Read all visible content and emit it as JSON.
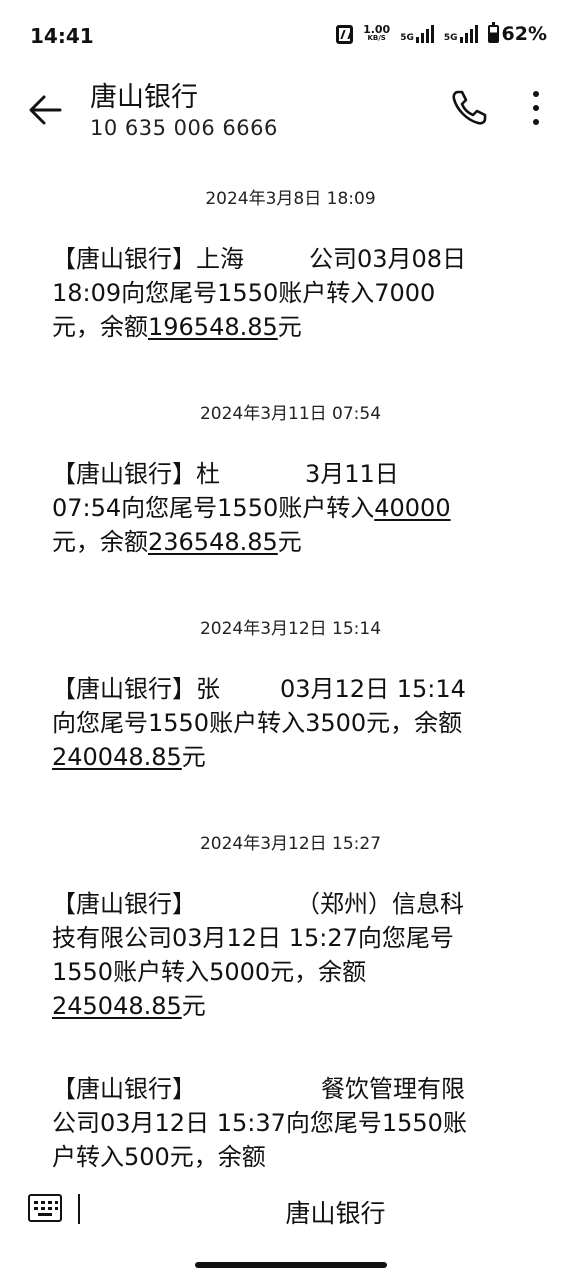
{
  "status_bar": {
    "time": "14:41",
    "speed_value": "1.00",
    "speed_unit": "KB/S",
    "net1": "5G",
    "net2": "5G",
    "battery": "62%"
  },
  "header": {
    "title": "唐山银行",
    "subtitle": "10 635 006 6666",
    "icons": [
      "back-arrow-icon",
      "phone-icon",
      "more-vert-icon"
    ]
  },
  "messages": [
    {
      "timestamp": "2024年3月8日 18:09",
      "prefix": "【唐山银行】上海",
      "body": "公司03月08日 18:09向您尾号1550账户转入7000元，余额",
      "balance": "196548.85",
      "suffix": "元"
    },
    {
      "timestamp": "2024年3月11日 07:54",
      "prefix": "【唐山银行】杜",
      "body": "3月11日 07:54向您尾号1550账户转入",
      "amount": "40000",
      "body2": "元，余额",
      "balance": "236548.85",
      "suffix": "元"
    },
    {
      "timestamp": "2024年3月12日 15:14",
      "prefix": "【唐山银行】张",
      "body": "03月12日 15:14向您尾号1550账户转入3500元，余额",
      "balance": "240048.85",
      "suffix": "元"
    },
    {
      "timestamp": "2024年3月12日 15:27",
      "prefix": "【唐山银行】",
      "body": "（郑州）信息科技有限公司03月12日 15:27向您尾号1550账户转入5000元，余额",
      "balance": "245048.85",
      "suffix": "元"
    },
    {
      "prefix": "【唐山银行】",
      "body": "餐饮管理有限公司03月12日 15:37向您尾号1550账户转入500元，余额"
    }
  ],
  "compose": {
    "sim_label": "唐山银行",
    "icon": "keyboard-icon"
  }
}
